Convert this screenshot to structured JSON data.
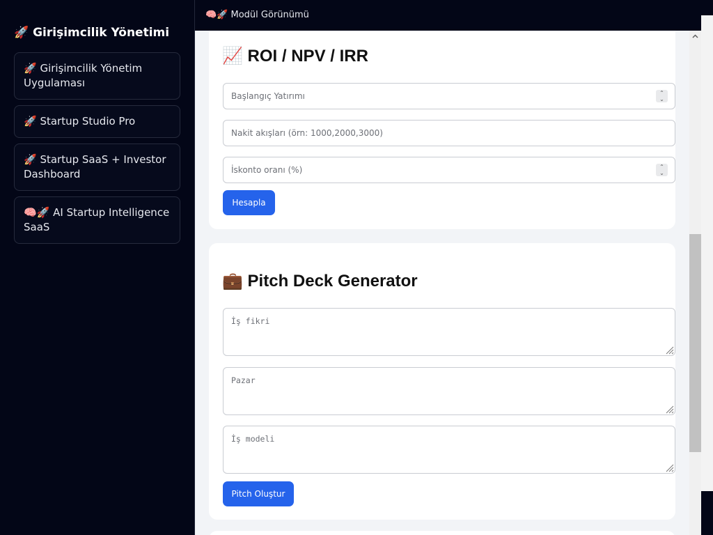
{
  "sidebar": {
    "title": "🚀 Girişimcilik Yönetimi",
    "items": [
      {
        "label": "🚀 Girişimcilik Yönetim Uygulaması"
      },
      {
        "label": "🚀 Startup Studio Pro"
      },
      {
        "label": "🚀 Startup SaaS + Investor Dashboard"
      },
      {
        "label": "🧠🚀 AI Startup Intelligence SaaS"
      }
    ]
  },
  "topbar": {
    "title": "🧠🚀 Modül Görünümü"
  },
  "roi_card": {
    "title": "📈 ROI / NPV / IRR",
    "initial_investment_placeholder": "Başlangıç Yatırımı",
    "cash_flows_placeholder": "Nakit akışları (örn: 1000,2000,3000)",
    "discount_rate_placeholder": "İskonto oranı (%)",
    "calculate_label": "Hesapla"
  },
  "pitch_card": {
    "title": "💼 Pitch Deck Generator",
    "idea_placeholder": "İş fikri",
    "market_placeholder": "Pazar",
    "model_placeholder": "İş modeli",
    "generate_label": "Pitch Oluştur"
  },
  "colors": {
    "sidebar_bg": "#030617",
    "main_bg": "#f2f4f7",
    "card_bg": "#ffffff",
    "primary_button": "#2563eb"
  }
}
